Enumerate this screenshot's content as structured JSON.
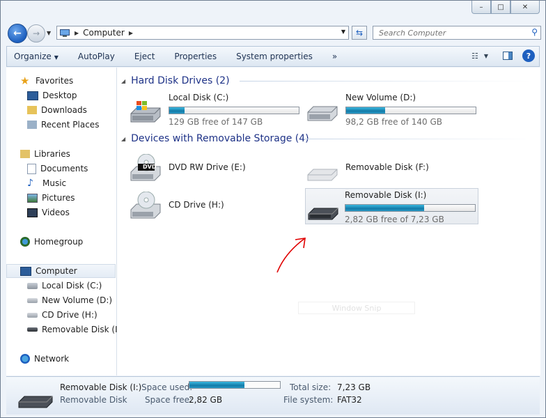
{
  "caption_buttons": {
    "minimize": "–",
    "maximize": "□",
    "close": "✕"
  },
  "address": {
    "root_label": "Computer"
  },
  "search": {
    "placeholder": "Search Computer"
  },
  "commands": {
    "organize": "Organize",
    "autoplay": "AutoPlay",
    "eject": "Eject",
    "properties": "Properties",
    "system_properties": "System properties",
    "more": "»"
  },
  "nav": {
    "favorites": {
      "label": "Favorites",
      "items": [
        "Desktop",
        "Downloads",
        "Recent Places"
      ]
    },
    "libraries": {
      "label": "Libraries",
      "items": [
        "Documents",
        "Music",
        "Pictures",
        "Videos"
      ]
    },
    "homegroup": "Homegroup",
    "computer": {
      "label": "Computer",
      "items": [
        "Local Disk (C:)",
        "New Volume (D:)",
        "CD Drive (H:)",
        "Removable Disk (I:)"
      ]
    },
    "network": "Network"
  },
  "groups": {
    "hdd": "Hard Disk Drives (2)",
    "removable": "Devices with Removable Storage (4)"
  },
  "drives": {
    "c": {
      "name": "Local Disk (C:)",
      "free": "129 GB free of 147 GB",
      "used_fraction": 0.12
    },
    "d": {
      "name": "New Volume (D:)",
      "free": "98,2 GB free of 140 GB",
      "used_fraction": 0.3
    },
    "e": {
      "name": "DVD RW Drive (E:)",
      "badge": "DVD"
    },
    "f": {
      "name": "Removable Disk (F:)"
    },
    "h": {
      "name": "CD Drive (H:)"
    },
    "i": {
      "name": "Removable Disk (I:)",
      "free": "2,82 GB free of 7,23 GB",
      "used_fraction": 0.61
    }
  },
  "ghost_text": "Window Snip",
  "details": {
    "name": "Removable Disk (I:)",
    "type": "Removable Disk",
    "space_used_label": "Space used:",
    "space_used_fraction": 0.61,
    "space_free_label": "Space free:",
    "space_free_value": "2,82 GB",
    "total_size_label": "Total size:",
    "total_size_value": "7,23 GB",
    "file_system_label": "File system:",
    "file_system_value": "FAT32"
  },
  "colors": {
    "accent": "#1d5fbf",
    "group_header": "#1e3287",
    "progress": "#1a8fbf",
    "annotation": "#e00000"
  }
}
